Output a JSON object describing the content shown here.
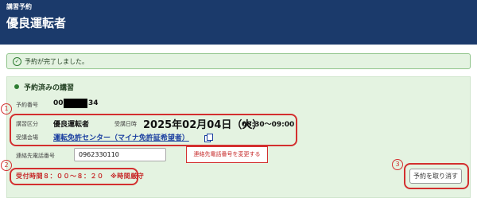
{
  "header": {
    "section": "講習予約",
    "title": "優良運転者"
  },
  "alert": {
    "icon": "check-circle-icon",
    "message": "予約が完了しました。"
  },
  "panel": {
    "title": "予約済みの講習",
    "reservation_number_label": "予約番号",
    "reservation_number_prefix": "00",
    "reservation_number_suffix": "34",
    "course_category_label": "講習区分",
    "course_category": "優良運転者",
    "datetime_label": "受講日時",
    "date": "2025年02月04日（火）",
    "time": "08:30～09:00",
    "venue_label": "受講会場",
    "venue": "運転免許センター（マイナ免許証希望者）",
    "phone_label": "連絡先電話番号",
    "phone_value": "0962330110",
    "change_phone_button": "連絡先電話番号を変更する",
    "reception_time_note": "受付時間８：００～８：２０　※時間厳守",
    "cancel_button": "予約を取り消す"
  },
  "annotations": {
    "one": "1",
    "two": "2",
    "three": "3"
  },
  "colors": {
    "header_bg": "#1b3a6b",
    "panel_bg": "#e4f3e1",
    "annotation_red": "#d32f2f",
    "link_blue": "#1a3fa0"
  }
}
